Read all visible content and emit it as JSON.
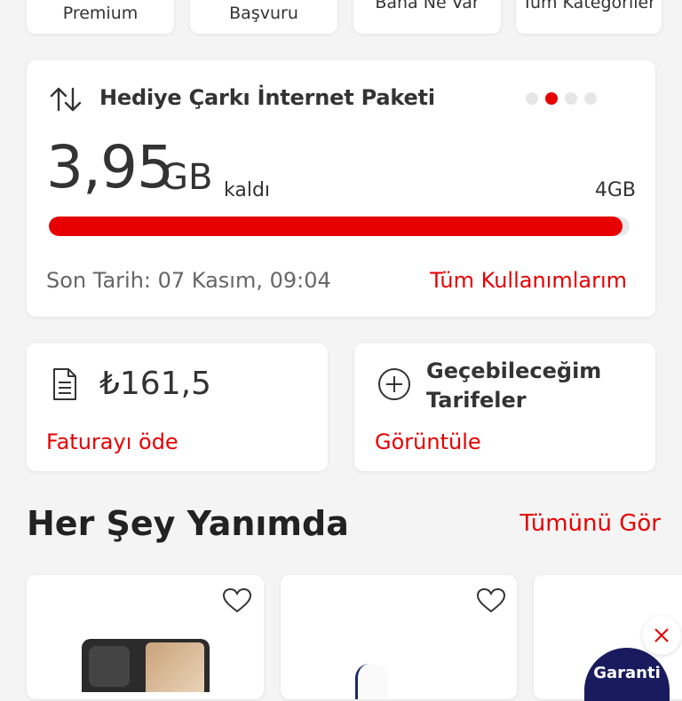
{
  "top_tiles": [
    {
      "label": "Premium"
    },
    {
      "label": "Başvuru"
    },
    {
      "label": "Bana Ne Var"
    },
    {
      "label": "Tüm Kategoriler"
    }
  ],
  "package": {
    "title": "Hediye Çarkı İnternet Paketi",
    "amount": "3,95",
    "unit": "GB",
    "remaining_label": "kaldı",
    "total": "4GB",
    "usage_fraction": 0.9875,
    "due_date": "Son Tarih: 07 Kasım, 09:04",
    "all_usage_link": "Tüm Kullanımlarım",
    "page_indicator": {
      "count": 4,
      "active": 1
    }
  },
  "bill": {
    "amount": "₺161,5",
    "pay_link": "Faturayı öde"
  },
  "tariffs": {
    "title_line1": "Geçebileceğim",
    "title_line2": "Tarifeler",
    "view_link": "Görüntüle"
  },
  "section": {
    "title": "Her Şey Yanımda",
    "see_all": "Tümünü Gör"
  },
  "promo": {
    "badge_text": "Garanti"
  },
  "colors": {
    "accent": "#e60000",
    "background": "#f4f4f4",
    "card": "#ffffff",
    "text": "#333333"
  }
}
